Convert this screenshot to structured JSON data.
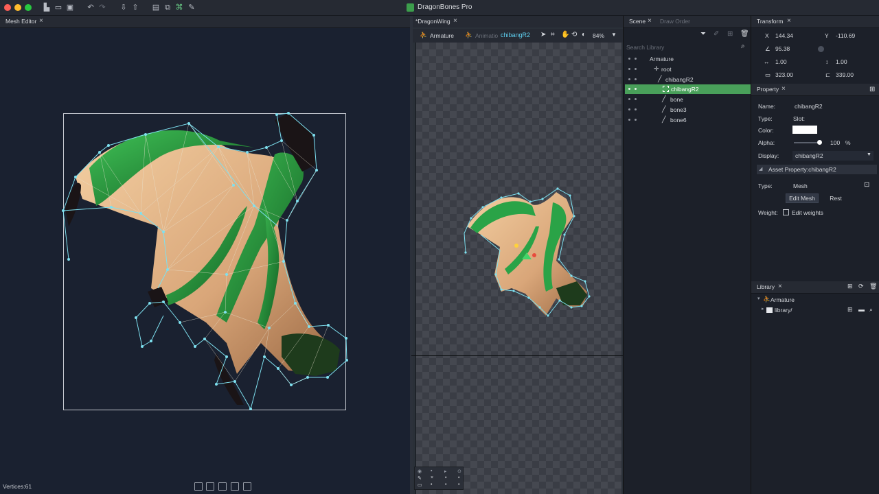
{
  "app": {
    "title": "DragonBones Pro"
  },
  "mesh_editor": {
    "tab": "Mesh Editor",
    "vertices_label": "Vertices:61"
  },
  "viewport": {
    "tab": "*DragonWing",
    "armature_tab": "Armature",
    "animation_tab": "Animatio",
    "selected_slot": "chibangR2",
    "zoom": "84%"
  },
  "scene": {
    "tab": "Scene",
    "draw_order_tab": "Draw Order",
    "search_placeholder": "Search Library",
    "tree": [
      {
        "label": "Armature"
      },
      {
        "label": "root"
      },
      {
        "label": "chibangR2"
      },
      {
        "label": "chibangR2"
      },
      {
        "label": "bone"
      },
      {
        "label": "bone3"
      },
      {
        "label": "bone6"
      }
    ]
  },
  "transform": {
    "tab": "Transform",
    "x_label": "X",
    "x": "144.34",
    "y_label": "Y",
    "y": "-110.69",
    "rotation": "95.38",
    "scale_x": "1.00",
    "scale_y": "1.00",
    "width": "323.00",
    "height": "339.00"
  },
  "property": {
    "tab": "Property",
    "name_label": "Name:",
    "name": "chibangR2",
    "type_label": "Type:",
    "type": "Slot:",
    "color_label": "Color:",
    "color": "#ffffff",
    "alpha_label": "Alpha:",
    "alpha": "100",
    "alpha_unit": "%",
    "display_label": "Display:",
    "display": "chibangR2",
    "asset_header": "Asset Property:chibangR2",
    "asset_type_label": "Type:",
    "asset_type": "Mesh",
    "edit_mesh": "Edit Mesh",
    "rest": "Rest",
    "weight_label": "Weight:",
    "edit_weights": "Edit weights"
  },
  "library": {
    "tab": "Library",
    "items": [
      {
        "label": "Armature"
      },
      {
        "label": "library/"
      }
    ]
  },
  "colors": {
    "accent": "#49a05a",
    "mesh_line": "#7ee0ef",
    "selected_text": "#5fd0f0"
  }
}
